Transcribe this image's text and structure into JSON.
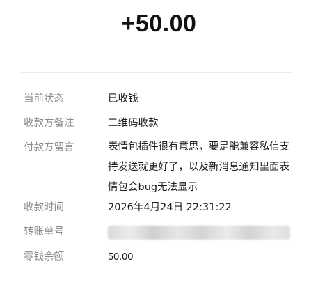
{
  "amount": "+50.00",
  "details": {
    "status_label": "当前状态",
    "status_value": "已收钱",
    "payee_note_label": "收款方备注",
    "payee_note_value": "二维码收款",
    "payer_message_label": "付款方留言",
    "payer_message_value": "表情包插件很有意思，要是能兼容私信支持发送就更好了，以及新消息通知里面表情包会bug无法显示",
    "time_label": "收款时间",
    "time_value": "2026年4月24日 22:31:22",
    "transfer_no_label": "转账单号",
    "balance_label": "零钱余额",
    "balance_value": "50.00"
  }
}
